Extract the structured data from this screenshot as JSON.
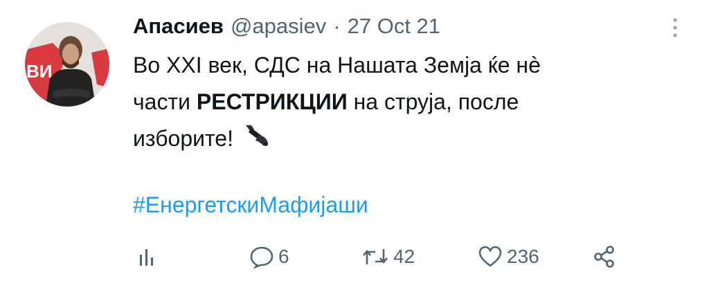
{
  "tweet": {
    "author_name": "Апасиев",
    "handle": "@apasiev",
    "separator": "·",
    "timestamp": "27 Oct 21",
    "body_line1": "Во XXI век, СДС на Нашата Земја ќе нè",
    "body_line2_a": "части ",
    "body_line2_bold": "РЕСТРИКЦИИ",
    "body_line2_b": " на струја, после",
    "body_line3": "изборите!",
    "emoji_icon": "electric-plug-icon",
    "hashtag": "#ЕнергетскиМафијаши"
  },
  "actions": {
    "analytics_icon": "analytics-icon",
    "reply_icon": "reply-icon",
    "reply_count": "6",
    "retweet_icon": "retweet-icon",
    "retweet_count": "42",
    "like_icon": "heart-icon",
    "like_count": "236",
    "share_icon": "share-icon"
  },
  "colors": {
    "accent": "#1d9bf0",
    "muted": "#536471",
    "text": "#0f1419"
  }
}
